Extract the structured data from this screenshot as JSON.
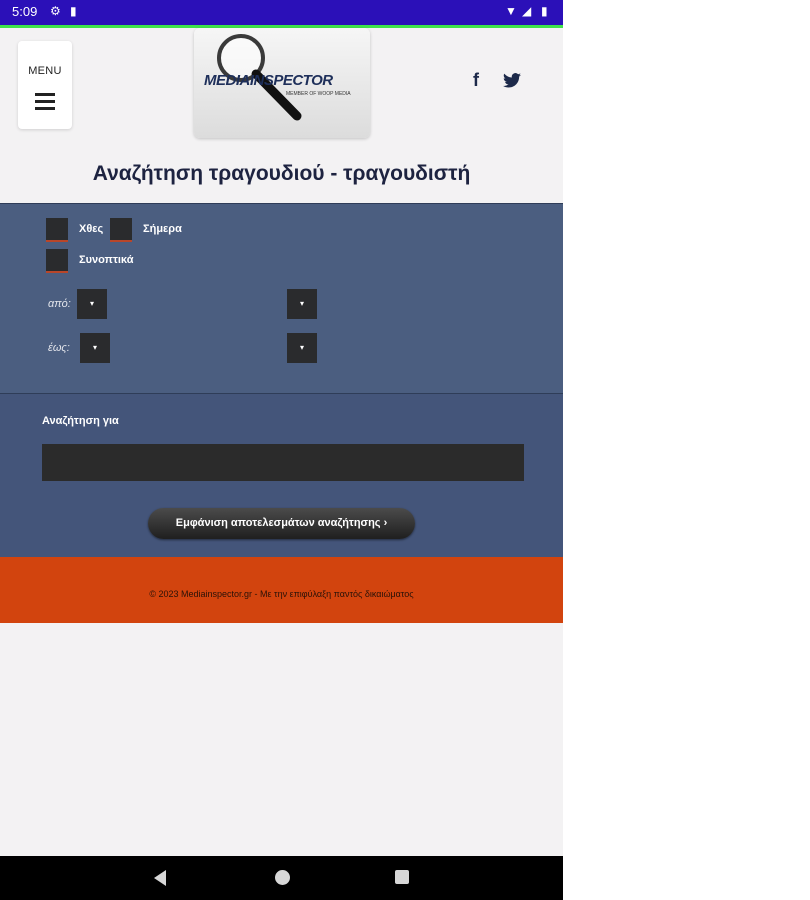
{
  "status_bar": {
    "time": "5:09",
    "icons": [
      "gear-icon",
      "sim-card-icon",
      "wifi-icon",
      "signal-icon",
      "battery-icon"
    ]
  },
  "header": {
    "menu_label": "MENU",
    "logo_text": "MEDIAINSPECTOR",
    "logo_subtitle": "MEMBER OF WOOP MEDIA",
    "social": [
      "facebook-icon",
      "twitter-icon"
    ]
  },
  "page_title": "Αναζήτηση τραγουδιού - τραγουδιστή",
  "filters": {
    "yesterday": "Χθες",
    "today": "Σήμερα",
    "summary": "Συνοπτικά",
    "from_label": "από:",
    "to_label": "έως:",
    "dropdown_glyph": "▾"
  },
  "search": {
    "label": "Αναζήτηση για",
    "value": "",
    "button": "Εμφάνιση αποτελεσμάτων αναζήτησης ›"
  },
  "footer": {
    "copyright": "© 2023 Mediainspector.gr - Με την επιφύλαξη παντός δικαιώματος"
  },
  "colors": {
    "status_bar": "#2b10b8",
    "panel": "#4b5e80",
    "footer": "#d2440e",
    "title": "#1d2340"
  }
}
